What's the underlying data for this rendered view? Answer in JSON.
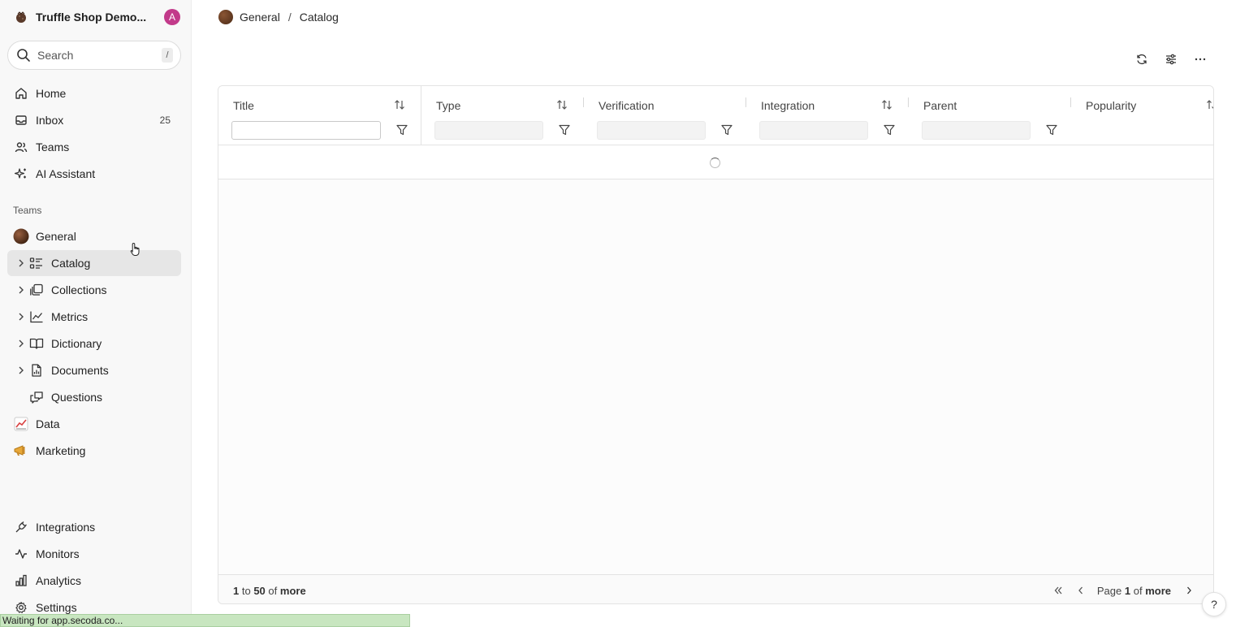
{
  "workspace": {
    "name": "Truffle Shop Demo...",
    "avatar_initial": "A",
    "avatar_color": "#c23a8a"
  },
  "search": {
    "placeholder": "Search",
    "shortcut": "/"
  },
  "nav": {
    "home": "Home",
    "inbox": "Inbox",
    "inbox_count": "25",
    "teams": "Teams",
    "ai": "AI Assistant"
  },
  "teams_section": {
    "label": "Teams",
    "general": "General",
    "sub": {
      "catalog": "Catalog",
      "collections": "Collections",
      "metrics": "Metrics",
      "dictionary": "Dictionary",
      "documents": "Documents",
      "questions": "Questions"
    },
    "data": "Data",
    "marketing": "Marketing"
  },
  "bottom_nav": {
    "integrations": "Integrations",
    "monitors": "Monitors",
    "analytics": "Analytics",
    "settings": "Settings"
  },
  "status_bar": "Waiting for app.secoda.co...",
  "breadcrumb": {
    "team": "General",
    "sep": "/",
    "page": "Catalog"
  },
  "table": {
    "columns": [
      "Title",
      "Type",
      "Verification",
      "Integration",
      "Parent",
      "Popularity"
    ]
  },
  "footer": {
    "range_from": "1",
    "range_to_word": "to",
    "range_to": "50",
    "of_word": "of",
    "range_total": "more",
    "page_word": "Page",
    "page_num": "1",
    "page_of": "of",
    "page_total": "more"
  },
  "help": "?",
  "colors": {
    "accent_avatar": "#c23a8a",
    "active_bg": "#e6e6e6",
    "status_bar_bg": "#c8e6c0"
  }
}
